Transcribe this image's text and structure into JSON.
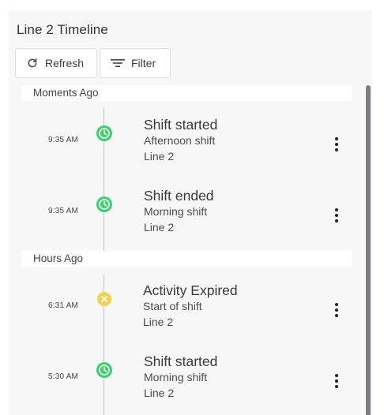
{
  "header": {
    "title": "Line 2 Timeline"
  },
  "toolbar": {
    "refresh_label": "Refresh",
    "filter_label": "Filter"
  },
  "colors": {
    "success": "#3ecf6e",
    "warning": "#f5cf52",
    "panel_bg": "#f7f7f8"
  },
  "groups": [
    {
      "label": "Moments Ago",
      "events": [
        {
          "time": "9:35 AM",
          "title": "Shift started",
          "subtitle": "Afternoon shift",
          "line": "Line 2",
          "status": "success",
          "icon": "clock-check-icon"
        },
        {
          "time": "9:35 AM",
          "title": "Shift ended",
          "subtitle": "Morning shift",
          "line": "Line 2",
          "status": "success",
          "icon": "clock-check-icon"
        }
      ]
    },
    {
      "label": "Hours Ago",
      "events": [
        {
          "time": "6:31 AM",
          "title": "Activity Expired",
          "subtitle": "Start of shift",
          "line": "Line 2",
          "status": "warning",
          "icon": "close-circle-icon"
        },
        {
          "time": "5:30 AM",
          "title": "Shift started",
          "subtitle": "Morning shift",
          "line": "Line 2",
          "status": "success",
          "icon": "clock-check-icon"
        }
      ]
    }
  ]
}
